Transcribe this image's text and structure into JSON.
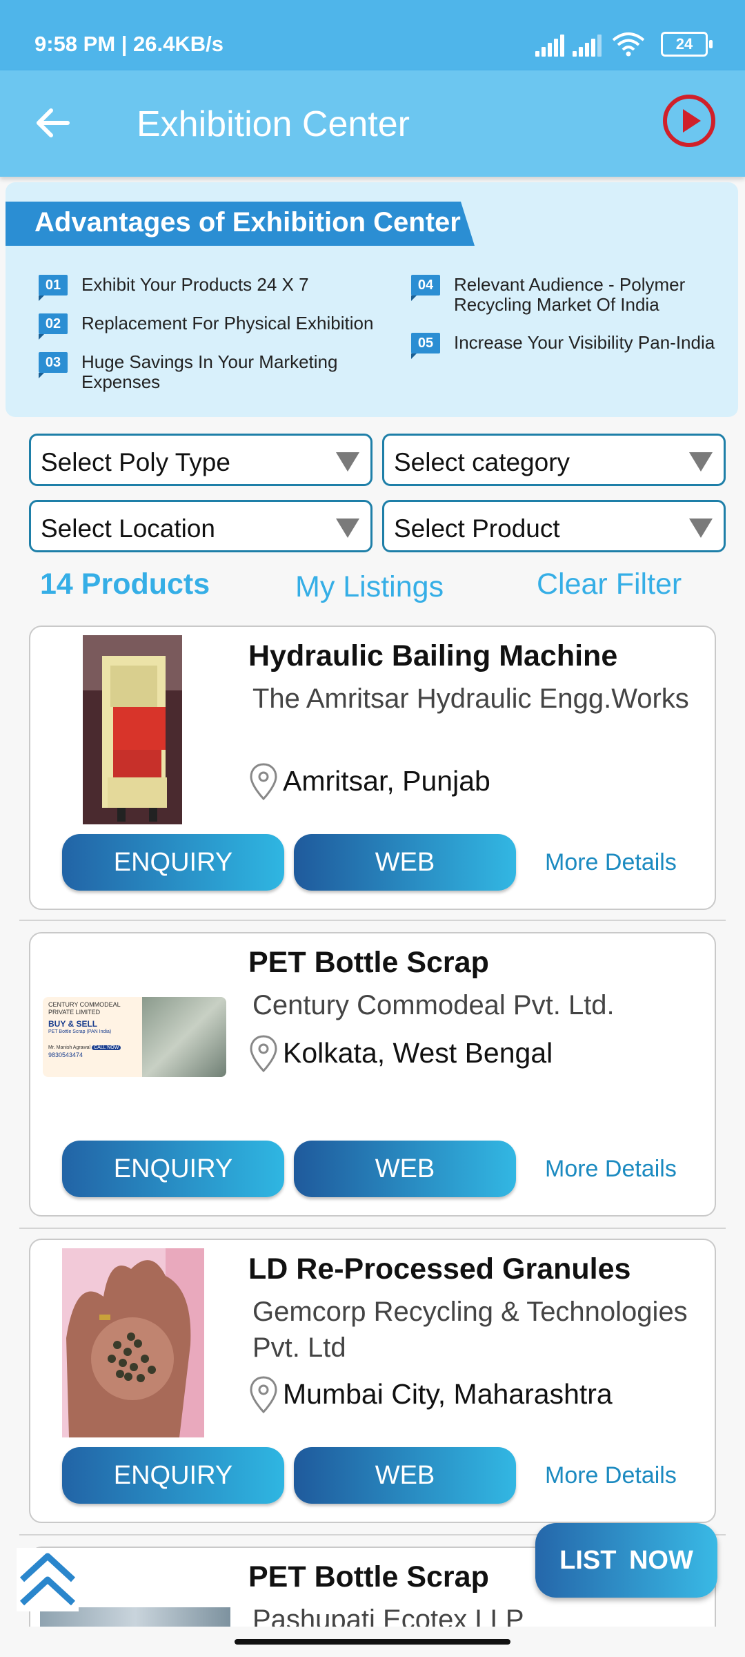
{
  "status": {
    "time": "9:58 PM | 26.4KB/s",
    "battery": "24"
  },
  "header": {
    "title": "Exhibition Center"
  },
  "advantages": {
    "title": "Advantages of Exhibition Center",
    "items": [
      {
        "num": "01",
        "text": "Exhibit Your Products 24 X 7"
      },
      {
        "num": "02",
        "text": "Replacement For Physical Exhibition"
      },
      {
        "num": "03",
        "text": "Huge Savings In Your Marketing Expenses"
      },
      {
        "num": "04",
        "text": "Relevant Audience - Polymer Recycling Market Of India"
      },
      {
        "num": "05",
        "text": "Increase Your Visibility Pan-India"
      }
    ]
  },
  "filters": {
    "poly_type": "Select Poly Type",
    "category": "Select category",
    "location": "Select Location",
    "product": "Select Product"
  },
  "actions": {
    "count": "14 Products",
    "my_listings": "My Listings",
    "clear_filter": "Clear Filter"
  },
  "products": [
    {
      "title": "Hydraulic Bailing Machine",
      "company": "The Amritsar Hydraulic Engg.Works",
      "location": "Amritsar, Punjab",
      "enquiry": "ENQUIRY",
      "web": "WEB",
      "more": "More Details"
    },
    {
      "title": "PET Bottle Scrap",
      "company": "Century Commodeal Pvt. Ltd.",
      "location": "Kolkata, West Bengal",
      "enquiry": "ENQUIRY",
      "web": "WEB",
      "more": "More Details",
      "image_text": {
        "line1": "CENTURY COMMODEAL",
        "line2": "PRIVATE LIMITED",
        "line3": "BUY & SELL",
        "line4": "PET Bottle Scrap (PAN India)",
        "line5": "Mr. Manish Agrawal",
        "call": "CALL NOW",
        "phone": "9830543474"
      }
    },
    {
      "title": "LD Re-Processed Granules",
      "company": "Gemcorp Recycling & Technologies Pvt. Ltd",
      "location": "Mumbai City, Maharashtra",
      "enquiry": "ENQUIRY",
      "web": "WEB",
      "more": "More Details"
    },
    {
      "title": "PET Bottle Scrap",
      "company": "Pashupati Ecotex LLP"
    }
  ],
  "fab": {
    "list_now": "LIST NOW"
  },
  "colors": {
    "status_bar": "#4fb5ea",
    "app_bar": "#6cc6f0",
    "accent": "#35aee6",
    "button_gradient_start": "#2264a6",
    "button_gradient_end": "#2fb6e2",
    "play_icon": "#d0202a"
  },
  "icons": [
    "back-arrow-icon",
    "play-icon",
    "location-pin-icon",
    "dropdown-arrow-icon",
    "scroll-top-icon"
  ]
}
